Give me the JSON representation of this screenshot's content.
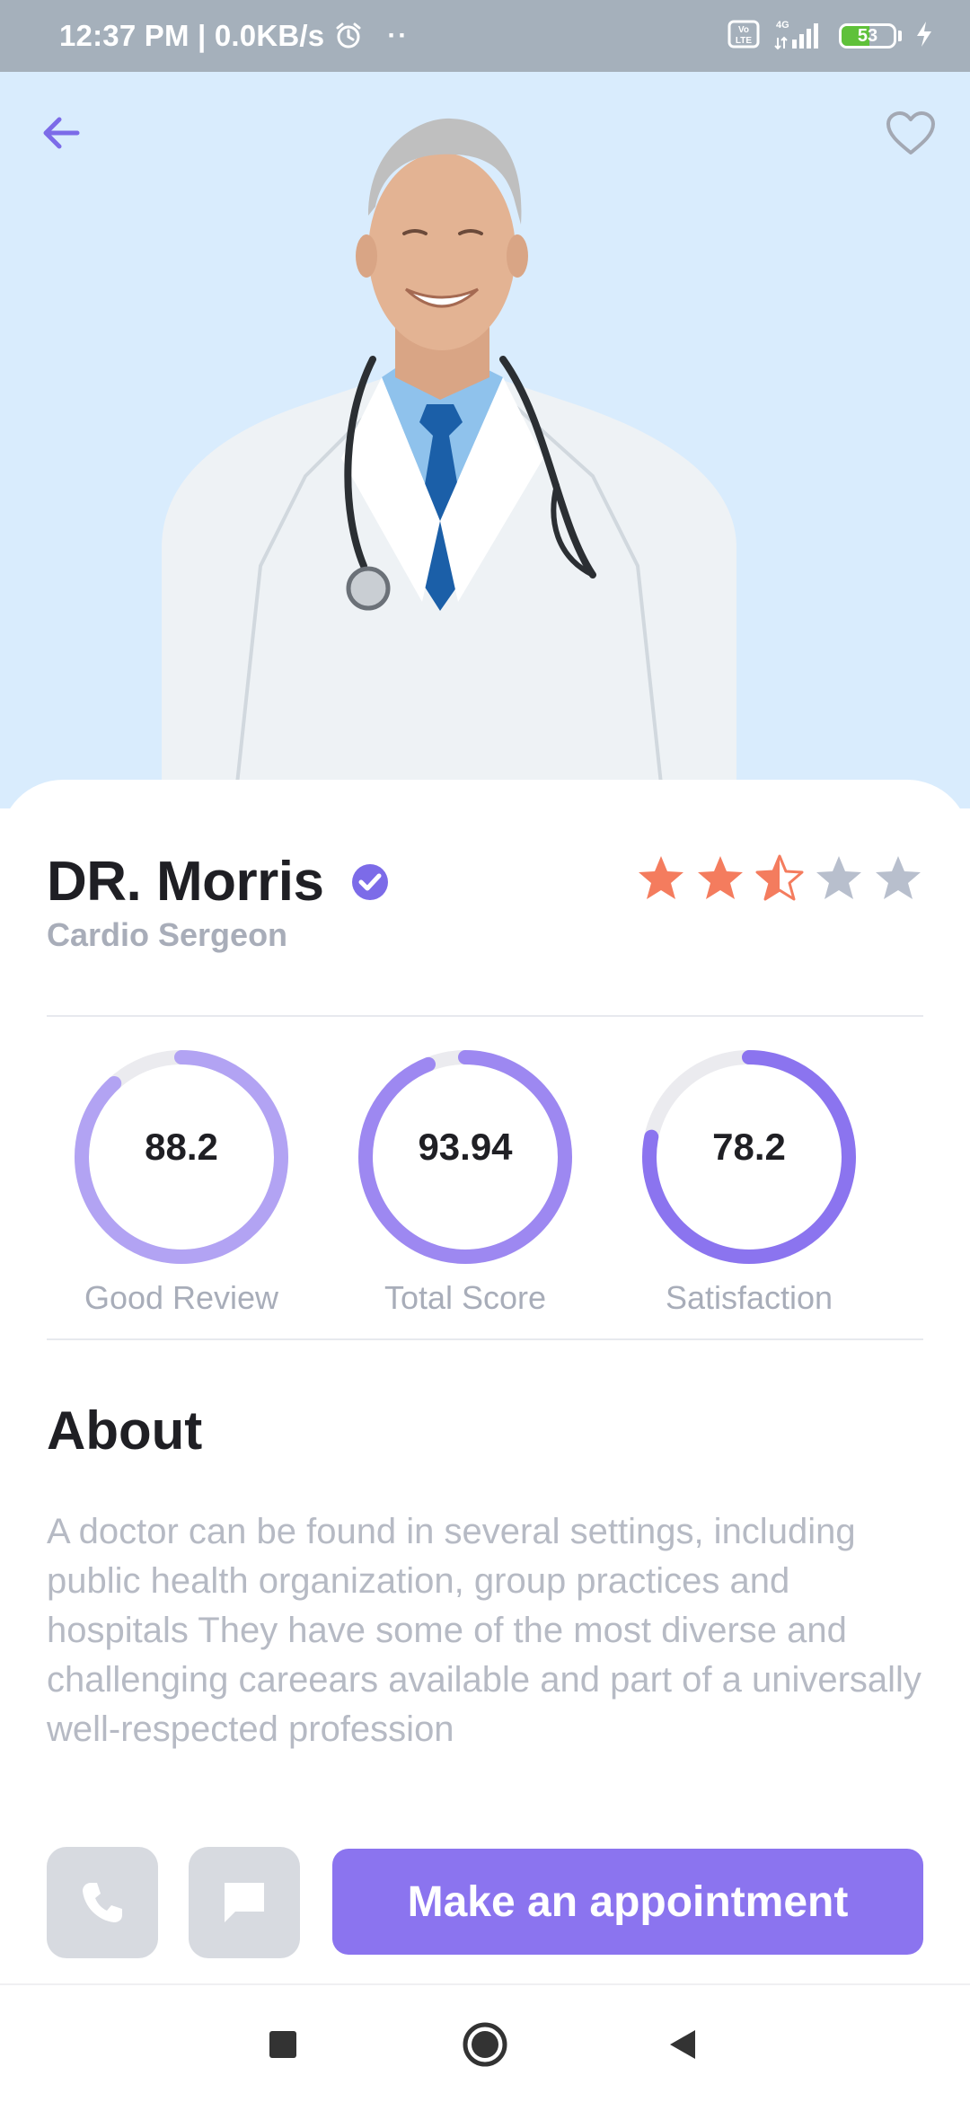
{
  "status_bar": {
    "time_speed": "12:37 PM | 0.0KB/s",
    "dots": "··",
    "volte": "Vo LTE",
    "network": "4G",
    "battery": "53",
    "battery_level": 0.53,
    "icons": [
      "alarm-icon",
      "volte-icon",
      "signal-icon",
      "battery-icon",
      "charging-icon"
    ]
  },
  "header": {
    "back_icon": "arrow-left-icon",
    "favorite_icon": "heart-outline-icon",
    "accent_color": "#7c6be8"
  },
  "doctor": {
    "name": "DR. Morris",
    "specialty": "Cardio Sergeon",
    "verified": true,
    "rating": 2.5,
    "rating_max": 5,
    "star_color": "#f47c5e",
    "star_empty_color": "#b8bfcd"
  },
  "stats": [
    {
      "value": "88.2",
      "label": "Good Review",
      "progress": 0.882,
      "color": "#b2a3f3"
    },
    {
      "value": "93.94",
      "label": "Total Score",
      "progress": 0.9394,
      "color": "#9d88f1"
    },
    {
      "value": "78.2",
      "label": "Satisfaction",
      "progress": 0.782,
      "color": "#8b74ef"
    }
  ],
  "about": {
    "title": "About",
    "text": "A doctor can be found in several settings, including public health organization, group practices and  hospitals They have some of the most diverse and challenging careears available and part of a universally well-respected profession"
  },
  "actions": {
    "call_icon": "phone-icon",
    "message_icon": "chat-icon",
    "appointment_label": "Make an appointment",
    "primary_color": "#8b74ef"
  },
  "nav": {
    "recents_icon": "square-icon",
    "home_icon": "circle-icon",
    "back_icon": "triangle-back-icon"
  }
}
